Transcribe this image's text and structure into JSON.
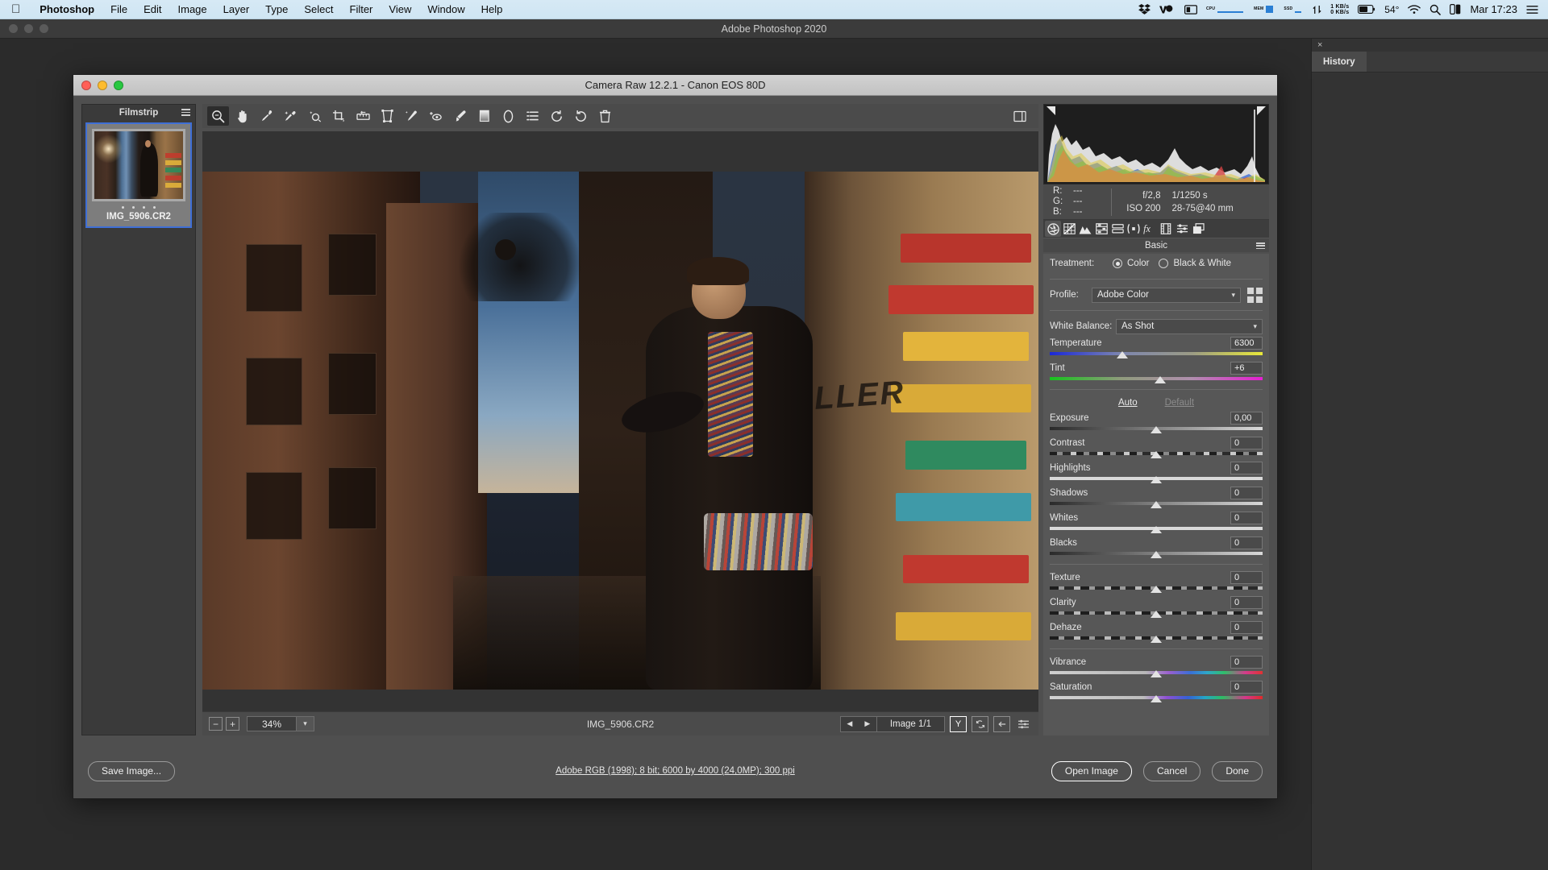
{
  "menubar": {
    "apple_icon": "apple-logo-icon",
    "items": [
      {
        "label": "Photoshop",
        "bold": true
      },
      {
        "label": "File",
        "bold": false
      },
      {
        "label": "Edit",
        "bold": false
      },
      {
        "label": "Image",
        "bold": false
      },
      {
        "label": "Layer",
        "bold": false
      },
      {
        "label": "Type",
        "bold": false
      },
      {
        "label": "Select",
        "bold": false
      },
      {
        "label": "Filter",
        "bold": false
      },
      {
        "label": "View",
        "bold": false
      },
      {
        "label": "Window",
        "bold": false
      },
      {
        "label": "Help",
        "bold": false
      }
    ],
    "status": {
      "dropbox_icon": "dropbox-icon",
      "we_icon": "wetransfer-icon",
      "display_icon": "display-icon",
      "cpu_label": "CPU",
      "mem_label": "MEM",
      "ssd_label": "SSD",
      "net_rate_up": "1 KB/s",
      "net_rate_down": "0 KB/s",
      "battery_pct": "54°",
      "wifi_icon": "wifi-icon",
      "search_icon": "search-icon",
      "controlcenter_icon": "control-center-icon",
      "clock": "Mar 17:23",
      "menu_icon": "hamburger-icon"
    }
  },
  "photoshop": {
    "title": "Adobe Photoshop 2020",
    "right_dock": {
      "close_label": "×",
      "tab_label": "History"
    }
  },
  "camera_raw": {
    "title": "Camera Raw 12.2.1  -  Canon EOS 80D",
    "filmstrip": {
      "header": "Filmstrip",
      "menu_icon": "panel-menu-icon",
      "thumbnail_name": "IMG_5906.CR2",
      "rating_dots": 4
    },
    "toolbar": [
      {
        "name": "zoom-tool-icon",
        "active": true
      },
      {
        "name": "hand-tool-icon",
        "active": false
      },
      {
        "name": "white-balance-eyedropper-icon",
        "active": false
      },
      {
        "name": "color-sampler-icon",
        "active": false
      },
      {
        "name": "targeted-adjustment-icon",
        "active": false
      },
      {
        "name": "crop-tool-icon",
        "active": false
      },
      {
        "name": "straighten-tool-icon",
        "active": false
      },
      {
        "name": "transform-tool-icon",
        "active": false
      },
      {
        "name": "spot-removal-icon",
        "active": false
      },
      {
        "name": "red-eye-removal-icon",
        "active": false
      },
      {
        "name": "adjustment-brush-icon",
        "active": false
      },
      {
        "name": "graduated-filter-icon",
        "active": false
      },
      {
        "name": "radial-filter-icon",
        "active": false
      },
      {
        "name": "preferences-icon",
        "active": false
      },
      {
        "name": "rotate-left-icon",
        "active": false
      },
      {
        "name": "rotate-right-icon",
        "active": false
      },
      {
        "name": "delete-icon",
        "active": false
      }
    ],
    "toolbar_right_icon": "toggle-fullscreen-icon",
    "preview": {
      "zoom_out_icon": "zoom-out-icon",
      "zoom_in_icon": "zoom-in-icon",
      "zoom_level": "34%",
      "zoom_caret_icon": "chevron-down-icon",
      "filename": "IMG_5906.CR2",
      "prev_icon": "previous-image-icon",
      "next_icon": "next-image-icon",
      "image_counter": "Image 1/1",
      "ybutton_label": "Y",
      "sync_icon": "sync-icon",
      "filmstrip-toggle-icon": "filmstrip-toggle-icon",
      "settings_icon": "sliders-icon"
    },
    "histogram": {
      "shadow_clip_icon": "shadow-clipping-icon",
      "highlight_clip_icon": "highlight-clipping-icon"
    },
    "exif": {
      "r_label": "R:",
      "r_value": "---",
      "g_label": "G:",
      "g_value": "---",
      "b_label": "B:",
      "b_value": "---",
      "aperture": "f/2,8",
      "shutter": "1/1250 s",
      "iso": "ISO 200",
      "lens": "28-75@40 mm"
    },
    "panel_tabs": [
      {
        "name": "basic-tab-icon",
        "active": true
      },
      {
        "name": "tone-curve-tab-icon",
        "active": false
      },
      {
        "name": "detail-tab-icon",
        "active": false
      },
      {
        "name": "hsl-tab-icon",
        "active": false
      },
      {
        "name": "split-toning-tab-icon",
        "active": false
      },
      {
        "name": "lens-corrections-tab-icon",
        "active": false
      },
      {
        "name": "effects-tab-icon",
        "active": false
      },
      {
        "name": "calibration-tab-icon",
        "active": false
      },
      {
        "name": "presets-tab-icon",
        "active": false
      },
      {
        "name": "snapshots-tab-icon",
        "active": false
      }
    ],
    "panel_title": "Basic",
    "panel_menu_icon": "panel-menu-icon",
    "basic": {
      "treatment_label": "Treatment:",
      "treatment_color": "Color",
      "treatment_bw": "Black & White",
      "treatment_selected": "Color",
      "profile_label": "Profile:",
      "profile_value": "Adobe Color",
      "profile_browser_icon": "profile-browser-icon",
      "white_balance_label": "White Balance:",
      "white_balance_value": "As Shot",
      "auto_label": "Auto",
      "default_label": "Default",
      "sliders": [
        {
          "name": "Temperature",
          "value": "6300",
          "pos": 34,
          "bar": "temp"
        },
        {
          "name": "Tint",
          "value": "+6",
          "pos": 52,
          "bar": "tint"
        },
        {
          "name": "Exposure",
          "value": "0,00",
          "pos": 50,
          "bar": "gray"
        },
        {
          "name": "Contrast",
          "value": "0",
          "pos": 50,
          "bar": "contrast"
        },
        {
          "name": "Highlights",
          "value": "0",
          "pos": 50,
          "bar": "flatlight"
        },
        {
          "name": "Shadows",
          "value": "0",
          "pos": 50,
          "bar": "gray"
        },
        {
          "name": "Whites",
          "value": "0",
          "pos": 50,
          "bar": "flatlight"
        },
        {
          "name": "Blacks",
          "value": "0",
          "pos": 50,
          "bar": "gray"
        },
        {
          "name": "Texture",
          "value": "0",
          "pos": 50,
          "bar": "texture"
        },
        {
          "name": "Clarity",
          "value": "0",
          "pos": 50,
          "bar": "texture"
        },
        {
          "name": "Dehaze",
          "value": "0",
          "pos": 50,
          "bar": "texture"
        },
        {
          "name": "Vibrance",
          "value": "0",
          "pos": 50,
          "bar": "vib"
        },
        {
          "name": "Saturation",
          "value": "0",
          "pos": 50,
          "bar": "sat"
        }
      ]
    },
    "footer": {
      "save_image": "Save Image...",
      "workflow_options": "Adobe RGB (1998); 8 bit; 6000 by 4000 (24,0MP); 300 ppi",
      "open_image": "Open Image",
      "cancel": "Cancel",
      "done": "Done"
    }
  }
}
